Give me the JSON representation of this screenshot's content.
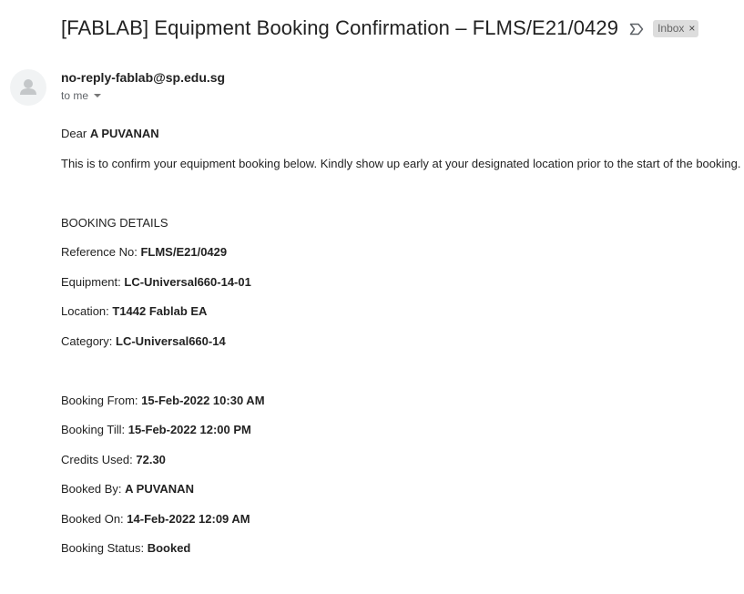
{
  "email": {
    "subject": "[FABLAB] Equipment Booking Confirmation – FLMS/E21/0429",
    "label_chip": "Inbox",
    "label_chip_close": "×",
    "sender": "no-reply-fablab@sp.edu.sg",
    "recipient_line": "to me"
  },
  "body": {
    "greeting_prefix": "Dear",
    "greeting_name": "A PUVANAN",
    "intro": "This is to confirm your equipment booking below. Kindly show up early at your designated location prior to the start of the booking.",
    "section_heading": "BOOKING DETAILS",
    "details_group1": [
      {
        "label": "Reference No:",
        "value": "FLMS/E21/0429"
      },
      {
        "label": "Equipment:",
        "value": "LC-Universal660-14-01"
      },
      {
        "label": "Location:",
        "value": "T1442 Fablab EA"
      },
      {
        "label": "Category:",
        "value": "LC-Universal660-14"
      }
    ],
    "details_group2": [
      {
        "label": "Booking From:",
        "value": "15-Feb-2022 10:30 AM"
      },
      {
        "label": "Booking Till:",
        "value": "15-Feb-2022 12:00 PM"
      },
      {
        "label": "Credits Used:",
        "value": "72.30"
      },
      {
        "label": "Booked By:",
        "value": "A PUVANAN"
      },
      {
        "label": "Booked On:",
        "value": "14-Feb-2022 12:09 AM"
      },
      {
        "label": "Booking Status:",
        "value": "Booked"
      }
    ]
  },
  "icons": {
    "important_marker": "label-important-outline-icon",
    "avatar": "default-person-avatar-icon",
    "recipient_details": "caret-down-icon"
  }
}
